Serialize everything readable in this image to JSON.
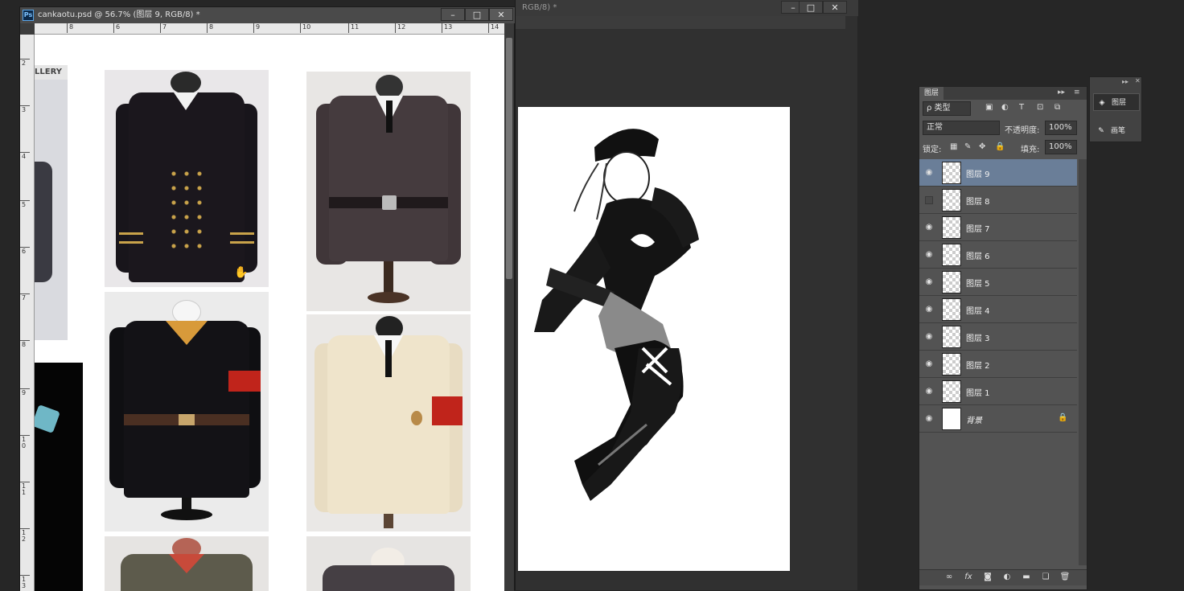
{
  "doc1": {
    "title": "cankaotu.psd @ 56.7% (图层 9, RGB/8) *",
    "logo": "Ps",
    "ruler_h": [
      "8",
      "6",
      "7",
      "8",
      "9",
      "10",
      "11",
      "12",
      "13",
      "14"
    ],
    "ruler_v": [
      "2",
      "3",
      "4",
      "5",
      "6",
      "7",
      "8",
      "9",
      "1 0",
      "1 1",
      "1 2",
      "1 3"
    ],
    "ref_label": "LLERY"
  },
  "doc2": {
    "title": "RGB/8) *"
  },
  "window_buttons": {
    "minimize": "–",
    "maximize": "□",
    "close": "✕"
  },
  "layers_panel": {
    "tab_label": "图层",
    "filter_label": "ρ 类型",
    "blend_mode": "正常",
    "opacity_label": "不透明度:",
    "opacity_value": "100%",
    "lock_label": "锁定:",
    "fill_label": "填充:",
    "fill_value": "100%",
    "layers": [
      {
        "name": "图层 9",
        "visible": true,
        "selected": true
      },
      {
        "name": "图层 8",
        "visible": false,
        "selected": false
      },
      {
        "name": "图层 7",
        "visible": true,
        "selected": false
      },
      {
        "name": "图层 6",
        "visible": true,
        "selected": false
      },
      {
        "name": "图层 5",
        "visible": true,
        "selected": false
      },
      {
        "name": "图层 4",
        "visible": true,
        "selected": false
      },
      {
        "name": "图层 3",
        "visible": true,
        "selected": false
      },
      {
        "name": "图层 2",
        "visible": true,
        "selected": false
      },
      {
        "name": "图层 1",
        "visible": true,
        "selected": false
      },
      {
        "name": "背景",
        "visible": true,
        "selected": false,
        "locked": true
      }
    ],
    "footer_icons": [
      "link-icon",
      "fx-icon",
      "mask-icon",
      "adjustment-icon",
      "folder-icon",
      "new-layer-icon",
      "trash-icon"
    ]
  },
  "side_panel": {
    "items": [
      {
        "label": "图层",
        "icon": "layers-icon"
      },
      {
        "label": "画笔",
        "icon": "brush-icon"
      }
    ]
  },
  "colors": {
    "selected_layer": "#6a7e98",
    "armband": "#c0241b"
  }
}
